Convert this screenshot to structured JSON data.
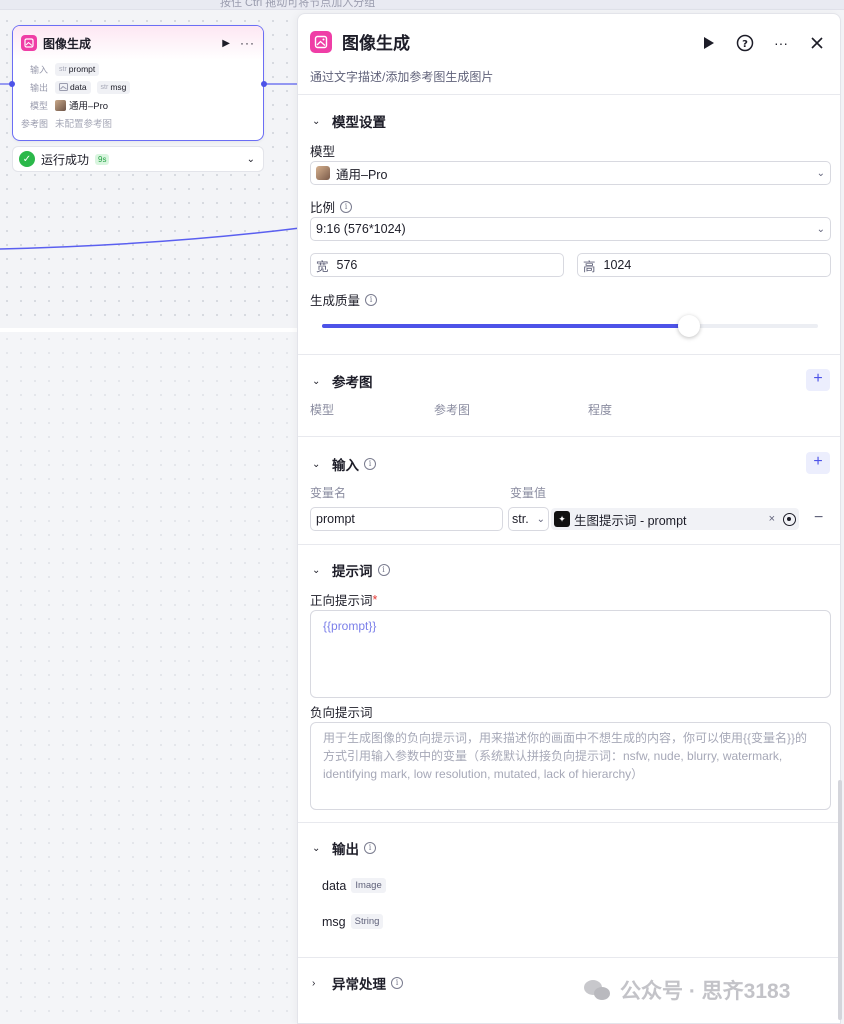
{
  "canvas": {
    "top_text": "按住 Ctrl 拖动可将节点加入分组"
  },
  "node": {
    "title": "图像生成",
    "rows": [
      {
        "key": "输入",
        "type": "str",
        "name": "prompt"
      },
      {
        "key": "输出",
        "items": [
          {
            "type": "img",
            "name": "data"
          },
          {
            "type": "str",
            "name": "msg"
          }
        ]
      },
      {
        "key": "模型",
        "value": "通用–Pro"
      },
      {
        "key": "参考图",
        "value": "未配置参考图"
      }
    ],
    "play_icon": "play-icon",
    "more_icon": "more-icon"
  },
  "status": {
    "text": "运行成功",
    "badge": "9s"
  },
  "panel": {
    "title": "图像生成",
    "description": "通过文字描述/添加参考图生成图片",
    "accent": "#4d53e8",
    "brand": "#ef3ea6",
    "model_section": {
      "title": "模型设置",
      "model_label": "模型",
      "model_value": "通用–Pro",
      "ratio_label": "比例",
      "ratio_value": "9:16 (576*1024)",
      "width_prefix": "宽",
      "width_value": "576",
      "height_prefix": "高",
      "height_value": "1024",
      "quality_label": "生成质量",
      "quality_level": 0.74
    },
    "reference_section": {
      "title": "参考图",
      "columns": [
        "模型",
        "参考图",
        "程度"
      ]
    },
    "input_section": {
      "title": "输入",
      "col_name": "变量名",
      "col_value": "变量值",
      "var_name": "prompt",
      "var_type": "str.",
      "ref_value": "生图提示词 - prompt"
    },
    "prompt_section": {
      "title": "提示词",
      "positive_label": "正向提示词",
      "required_mark": "*",
      "positive_value": "{{prompt}}",
      "negative_label": "负向提示词",
      "negative_placeholder": "用于生成图像的负向提示词，用来描述你的画面中不想生成的内容，你可以使用{{变量名}}的方式引用输入参数中的变量（系统默认拼接负向提示词：nsfw, nude, blurry, watermark, identifying mark, low resolution, mutated, lack of hierarchy）"
    },
    "output_section": {
      "title": "输出",
      "items": [
        {
          "name": "data",
          "type": "Image"
        },
        {
          "name": "msg",
          "type": "String"
        }
      ]
    },
    "exception_section": {
      "title": "异常处理"
    }
  },
  "watermark": {
    "text": "公众号 · 思齐3183"
  }
}
